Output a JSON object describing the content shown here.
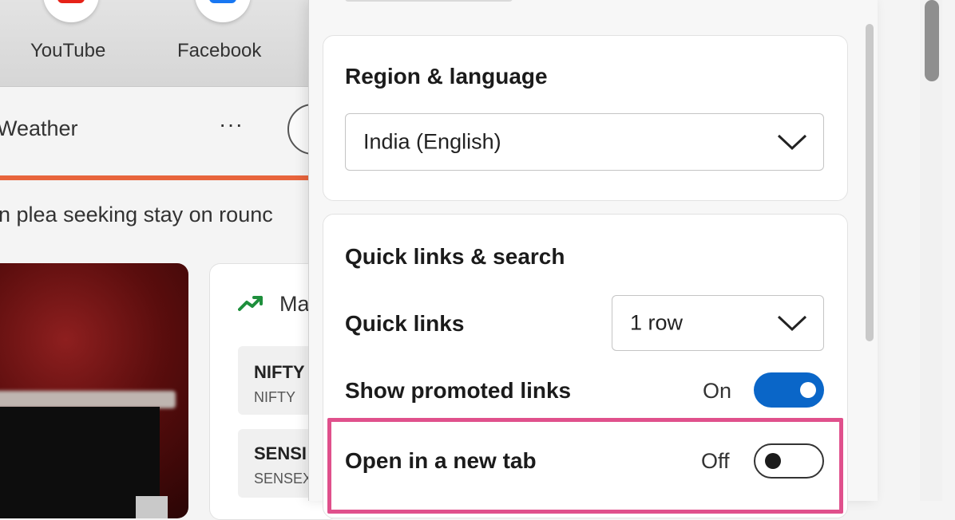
{
  "quick_links": [
    {
      "label": "YouTube",
      "icon": "youtube-icon",
      "color": "#e62117"
    },
    {
      "label": "Facebook",
      "icon": "facebook-icon",
      "color": "#1877f2"
    }
  ],
  "feed_nav": {
    "weather_label": "Weather",
    "more_label": "···"
  },
  "headline": "n plea seeking stay on rounc",
  "markets": {
    "title": "Ma",
    "stocks": [
      {
        "name": "NIFTY",
        "sub": "NIFTY"
      },
      {
        "name": "SENSI",
        "sub": "SENSEX"
      }
    ]
  },
  "settings": {
    "region_card": {
      "title": "Region & language",
      "selected": "India (English)"
    },
    "quicklinks_card": {
      "title": "Quick links & search",
      "quick_links_label": "Quick links",
      "quick_links_value": "1 row",
      "promoted_label": "Show promoted links",
      "promoted_state": "On",
      "new_tab_label": "Open in a new tab",
      "new_tab_state": "Off"
    },
    "accent_color": "#0a66c8",
    "highlight_color": "#e0508c"
  }
}
